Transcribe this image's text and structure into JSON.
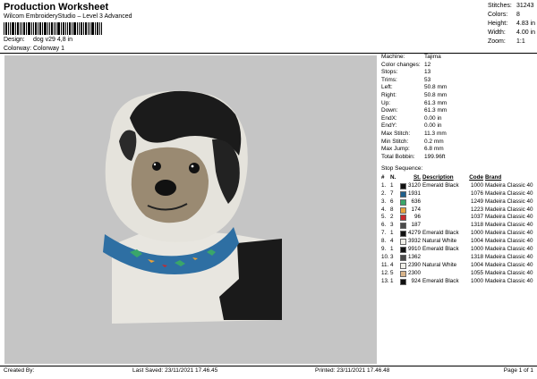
{
  "header": {
    "title": "Production Worksheet",
    "subtitle": "Wilcom EmbroideryStudio – Level 3 Advanced",
    "design_label": "Design:",
    "design_value": "dog v29 4,8 in",
    "colorway_label": "Colorway:",
    "colorway_value": "Colorway 1"
  },
  "stats": [
    {
      "label": "Stitches:",
      "value": "31243"
    },
    {
      "label": "Colors:",
      "value": "8"
    },
    {
      "label": "Height:",
      "value": "4.83 in"
    },
    {
      "label": "Width:",
      "value": "4.00 in"
    },
    {
      "label": "Zoom:",
      "value": "1:1"
    }
  ],
  "details": [
    {
      "label": "Machine:",
      "value": "Tajima"
    },
    {
      "label": "Color changes:",
      "value": "12"
    },
    {
      "label": "Stops:",
      "value": "13"
    },
    {
      "label": "Trims:",
      "value": "53"
    },
    {
      "label": "Left:",
      "value": "50.8 mm"
    },
    {
      "label": "Right:",
      "value": "50.8 mm"
    },
    {
      "label": "Up:",
      "value": "61.3 mm"
    },
    {
      "label": "Down:",
      "value": "61.3 mm"
    },
    {
      "label": "EndX:",
      "value": "0.00 in"
    },
    {
      "label": "EndY:",
      "value": "0.00 in"
    },
    {
      "label": "Max Stitch:",
      "value": "11.3 mm"
    },
    {
      "label": "Min Stitch:",
      "value": "0.2 mm"
    },
    {
      "label": "Max Jump:",
      "value": "6.8 mm"
    },
    {
      "label": "Total Bobbin:",
      "value": "199.96ft"
    }
  ],
  "stop_sequence": {
    "title": "Stop Sequence:",
    "headers": {
      "num": "#",
      "n": "N.",
      "st": "St.",
      "description": "Description",
      "code": "Code",
      "brand": "Brand"
    },
    "rows": [
      {
        "num": "1.",
        "n": "1",
        "color": "#111111",
        "st": "3120",
        "description": "Emerald Black",
        "code": "1000",
        "brand": "Madeira Classic 40"
      },
      {
        "num": "2.",
        "n": "7",
        "color": "#1f5f8b",
        "st": "1931",
        "description": "",
        "code": "1076",
        "brand": "Madeira Classic 40"
      },
      {
        "num": "3.",
        "n": "6",
        "color": "#3aa66a",
        "st": "636",
        "description": "",
        "code": "1249",
        "brand": "Madeira Classic 40"
      },
      {
        "num": "4.",
        "n": "8",
        "color": "#e8a13a",
        "st": "174",
        "description": "",
        "code": "1223",
        "brand": "Madeira Classic 40"
      },
      {
        "num": "5.",
        "n": "2",
        "color": "#c8282e",
        "st": "96",
        "description": "",
        "code": "1037",
        "brand": "Madeira Classic 40"
      },
      {
        "num": "6.",
        "n": "3",
        "color": "#4a4a4a",
        "st": "187",
        "description": "",
        "code": "1318",
        "brand": "Madeira Classic 40"
      },
      {
        "num": "7.",
        "n": "1",
        "color": "#111111",
        "st": "4279",
        "description": "Emerald Black",
        "code": "1000",
        "brand": "Madeira Classic 40"
      },
      {
        "num": "8.",
        "n": "4",
        "color": "#f0efe8",
        "st": "3932",
        "description": "Natural White",
        "code": "1004",
        "brand": "Madeira Classic 40"
      },
      {
        "num": "9.",
        "n": "1",
        "color": "#111111",
        "st": "9910",
        "description": "Emerald Black",
        "code": "1000",
        "brand": "Madeira Classic 40"
      },
      {
        "num": "10.",
        "n": "3",
        "color": "#4a4a4a",
        "st": "1362",
        "description": "",
        "code": "1318",
        "brand": "Madeira Classic 40"
      },
      {
        "num": "11.",
        "n": "4",
        "color": "#f0efe8",
        "st": "2390",
        "description": "Natural White",
        "code": "1004",
        "brand": "Madeira Classic 40"
      },
      {
        "num": "12.",
        "n": "5",
        "color": "#d7b38a",
        "st": "2300",
        "description": "",
        "code": "1055",
        "brand": "Madeira Classic 40"
      },
      {
        "num": "13.",
        "n": "1",
        "color": "#111111",
        "st": "924",
        "description": "Emerald Black",
        "code": "1000",
        "brand": "Madeira Classic 40"
      }
    ]
  },
  "footer": {
    "created": "Created By:",
    "saved": "Last Saved: 23/11/2021 17.46.45",
    "printed": "Printed: 23/11/2021 17.46.48",
    "page": "Page 1 of 1"
  },
  "colors": {
    "canvas_bg": "#c5c5c5"
  }
}
